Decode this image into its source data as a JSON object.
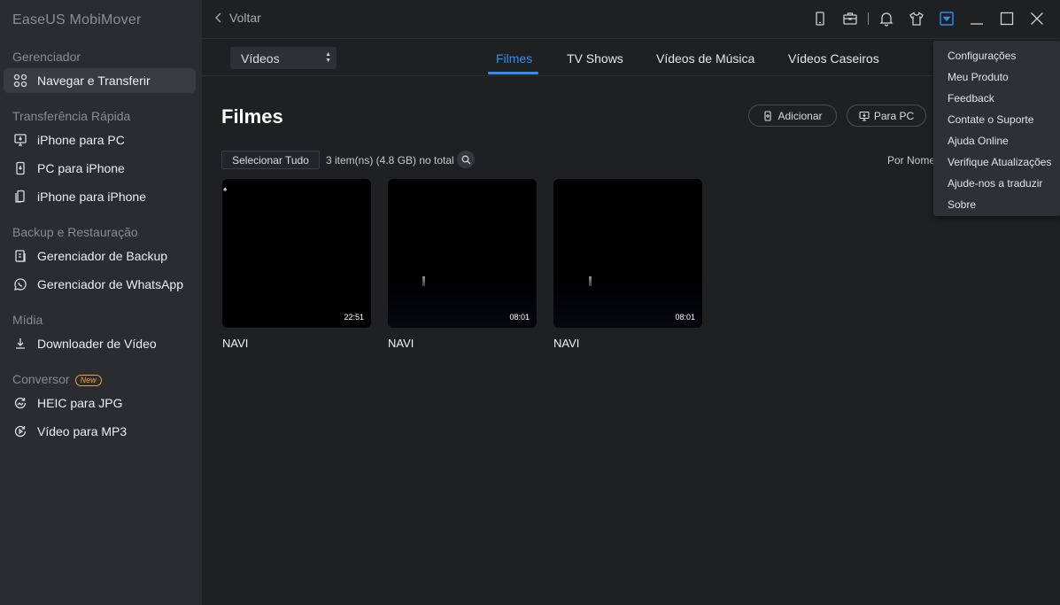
{
  "app": {
    "title": "EaseUS MobiMover"
  },
  "sidebar": {
    "sections": [
      {
        "label": "Gerenciador"
      },
      {
        "label": "Transferência Rápida"
      },
      {
        "label": "Backup e Restauração"
      },
      {
        "label": "Mídia"
      },
      {
        "label": "Conversor",
        "badge": "New"
      }
    ],
    "items": [
      {
        "label": "Navegar e Transferir",
        "icon": "grid-icon",
        "active": true
      },
      {
        "label": "iPhone para PC",
        "icon": "monitor-icon"
      },
      {
        "label": "PC para iPhone",
        "icon": "phone-icon"
      },
      {
        "label": "iPhone para iPhone",
        "icon": "phones-icon"
      },
      {
        "label": "Gerenciador de Backup",
        "icon": "backup-icon"
      },
      {
        "label": "Gerenciador de WhatsApp",
        "icon": "whatsapp-icon"
      },
      {
        "label": "Downloader de Vídeo",
        "icon": "download-icon"
      },
      {
        "label": "HEIC para JPG",
        "icon": "image-convert-icon"
      },
      {
        "label": "Vídeo para MP3",
        "icon": "audio-convert-icon"
      }
    ]
  },
  "topbar": {
    "back_label": "Voltar",
    "icons": [
      "device-icon",
      "toolbox-icon",
      "bell-icon",
      "shirt-icon",
      "menu-dropdown-icon",
      "minimize-icon",
      "maximize-icon",
      "close-icon"
    ]
  },
  "category_select": {
    "value": "Vídeos"
  },
  "tabs": [
    {
      "label": "Filmes",
      "active": true
    },
    {
      "label": "TV Shows"
    },
    {
      "label": "Vídeos de Música"
    },
    {
      "label": "Vídeos Caseiros"
    }
  ],
  "main": {
    "title": "Filmes",
    "add_label": "Adicionar",
    "to_pc_label": "Para PC",
    "select_all_label": "Selecionar Tudo",
    "count_text": "3 item(ns) (4.8 GB) no total",
    "sort_label": "Por Nome"
  },
  "videos": [
    {
      "name": "NAVI",
      "duration": "22:51"
    },
    {
      "name": "NAVI",
      "duration": "08:01"
    },
    {
      "name": "NAVI",
      "duration": "08:01"
    }
  ],
  "menu": {
    "items": [
      "Configurações",
      "Meu Produto",
      "Feedback",
      "Contate o Suporte",
      "Ajuda Online",
      "Verifique Atualizações",
      "Ajude-nos a traduzir",
      "Sobre"
    ]
  },
  "colors": {
    "accent": "#2f8ef4",
    "sidebar_bg": "#2b2c2f",
    "main_bg": "#1f2022",
    "badge": "#f0a23a"
  }
}
